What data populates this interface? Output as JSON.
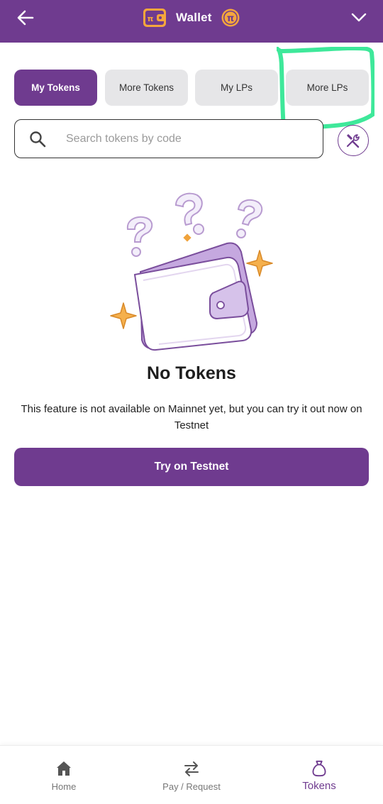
{
  "header": {
    "title": "Wallet",
    "back_icon": "arrow-left-icon",
    "menu_icon": "chevron-down-icon",
    "logo_icon": "wallet-logo-icon",
    "coin_icon": "pi-coin-icon",
    "background_color": "#6f3b8f"
  },
  "tabs": [
    {
      "label": "My Tokens",
      "active": true
    },
    {
      "label": "More Tokens",
      "active": false
    },
    {
      "label": "My LPs",
      "active": false
    },
    {
      "label": "More LPs",
      "active": false
    }
  ],
  "search": {
    "placeholder": "Search tokens by code",
    "value": "",
    "icon": "search-icon"
  },
  "tools_button": {
    "icon": "tools-icon"
  },
  "empty_state": {
    "illustration": "empty-wallet-illustration",
    "title": "No Tokens",
    "description": "This feature is not available on Mainnet yet, but you can try it out now on Testnet"
  },
  "cta": {
    "label": "Try on Testnet"
  },
  "bottom_nav": [
    {
      "label": "Home",
      "icon": "home-icon",
      "active": false
    },
    {
      "label": "Pay / Request",
      "icon": "swap-arrows-icon",
      "active": false
    },
    {
      "label": "Tokens",
      "icon": "token-bag-icon",
      "active": true
    }
  ],
  "colors": {
    "accent": "#6f3b8f",
    "tab_inactive": "#e6e6e8",
    "annotation_highlight": "#3ee89a",
    "sparkle": "#f0a33c"
  }
}
